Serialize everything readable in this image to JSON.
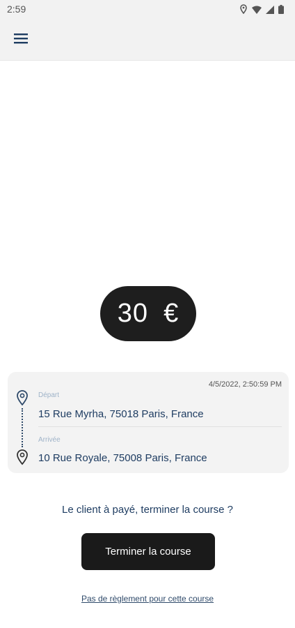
{
  "status_bar": {
    "time": "2:59",
    "icons": [
      "location-icon",
      "wifi-icon",
      "signal-icon",
      "battery-icon"
    ]
  },
  "app_bar": {
    "menu_icon": "hamburger-menu-icon"
  },
  "fare": {
    "amount": "30",
    "currency": "€"
  },
  "trip": {
    "datetime": "4/5/2022, 2:50:59 PM",
    "departure_label": "Départ",
    "departure_address": "15 Rue Myrha, 75018 Paris, France",
    "arrival_label": "Arrivée",
    "arrival_address": "10 Rue Royale, 75008 Paris, France"
  },
  "actions": {
    "question": "Le client à payé, terminer la course ?",
    "finish_label": "Terminer la course",
    "no_payment_link": "Pas de règlement pour cette course"
  },
  "colors": {
    "accent_navy": "#1f3d62",
    "pill_bg": "#1e1e1e",
    "button_bg": "#1a1a1a",
    "card_bg": "#f3f3f3"
  }
}
